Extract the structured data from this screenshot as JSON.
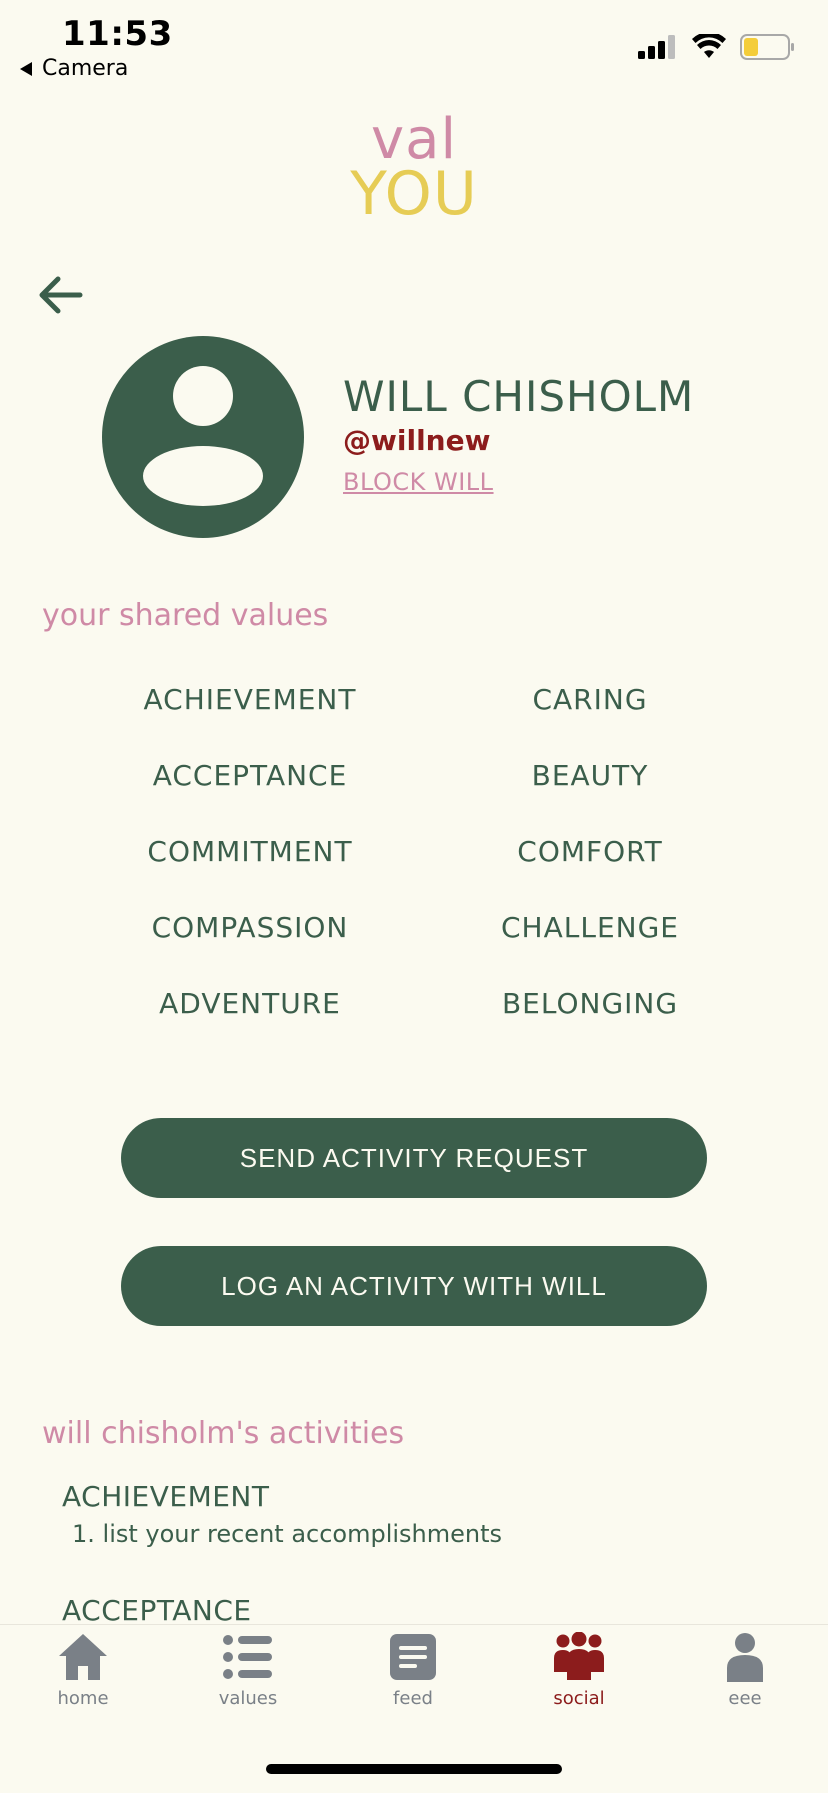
{
  "status_bar": {
    "time": "11:53",
    "back_app": "Camera",
    "signal_icon": "cellular-signal-icon",
    "wifi_icon": "wifi-icon",
    "battery_icon": "battery-low-icon"
  },
  "logo": {
    "line1": "val",
    "line2": "YOU"
  },
  "profile": {
    "name": "WILL CHISHOLM",
    "handle": "@willnew",
    "block_label": "BLOCK WILL"
  },
  "shared_values": {
    "title": "your shared values",
    "items": [
      "ACHIEVEMENT",
      "CARING",
      "ACCEPTANCE",
      "BEAUTY",
      "COMMITMENT",
      "COMFORT",
      "COMPASSION",
      "CHALLENGE",
      "ADVENTURE",
      "BELONGING"
    ]
  },
  "actions": {
    "send_request": "SEND ACTIVITY REQUEST",
    "log_activity": "LOG AN ACTIVITY WITH WILL"
  },
  "activities": {
    "title": "will chisholm's activities",
    "groups": [
      {
        "value": "ACHIEVEMENT",
        "items": [
          "1. list your recent accomplishments"
        ]
      },
      {
        "value": "ACCEPTANCE",
        "items": []
      }
    ]
  },
  "tabbar": {
    "tabs": [
      {
        "label": "home",
        "icon": "home-icon"
      },
      {
        "label": "values",
        "icon": "list-icon"
      },
      {
        "label": "feed",
        "icon": "feed-icon"
      },
      {
        "label": "social",
        "icon": "people-icon"
      },
      {
        "label": "eee",
        "icon": "person-icon"
      }
    ],
    "active": "social"
  },
  "colors": {
    "background": "#fbfaf0",
    "primary_green": "#3b5e4b",
    "accent_pink": "#cf8aa6",
    "accent_yellow": "#e6cc55",
    "accent_red": "#8c1c1c",
    "inactive_gray": "#7a8087"
  }
}
